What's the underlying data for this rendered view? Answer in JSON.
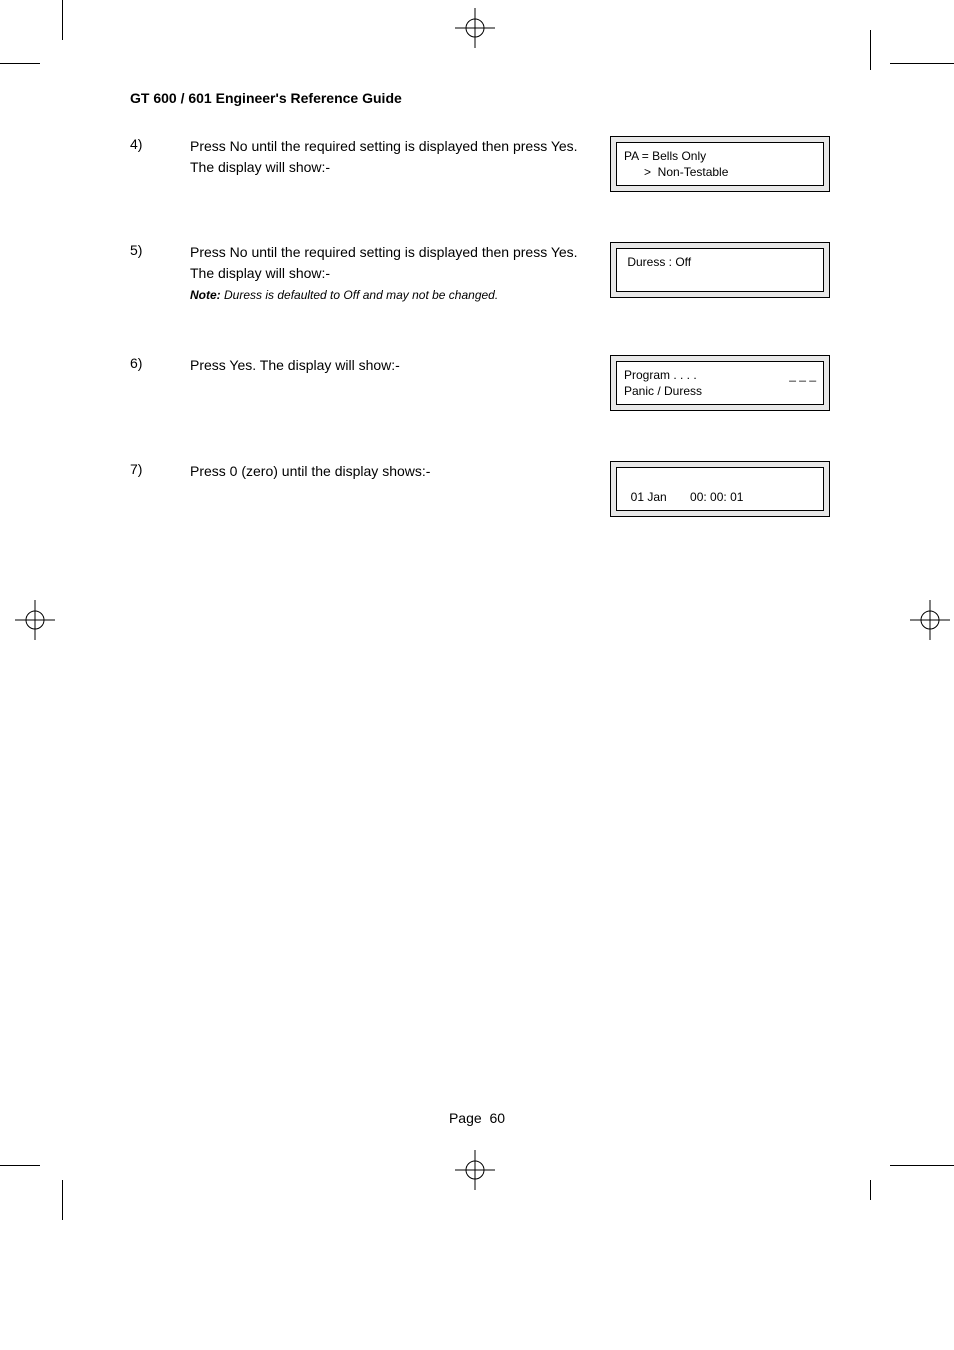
{
  "header": {
    "title": "GT 600 / 601 Engineer's Reference Guide"
  },
  "steps": [
    {
      "num": "4)",
      "text": "Press No until the required setting is displayed then press Yes. The display will show:-",
      "lcd": {
        "line1": "PA = Bells Only",
        "line2": "      >  Non-Testable"
      }
    },
    {
      "num": "5)",
      "text": "Press No until the required setting is displayed then press Yes. The display will show:-",
      "note_label": "Note:",
      "note_text": " Duress is defaulted to Off and may not be changed.",
      "lcd": {
        "line1": " Duress : Off",
        "line2": ""
      }
    },
    {
      "num": "6)",
      "text": "Press Yes. The display will show:-",
      "lcd": {
        "line1_left": "Program . . . .",
        "line1_right": "_ _ _",
        "line2": "Panic / Duress"
      }
    },
    {
      "num": "7)",
      "text": "Press 0 (zero) until the display shows:-",
      "lcd": {
        "line1": "",
        "line2": "  01 Jan       00: 00: 01"
      }
    }
  ],
  "footer": {
    "label": "Page",
    "num": "60"
  }
}
